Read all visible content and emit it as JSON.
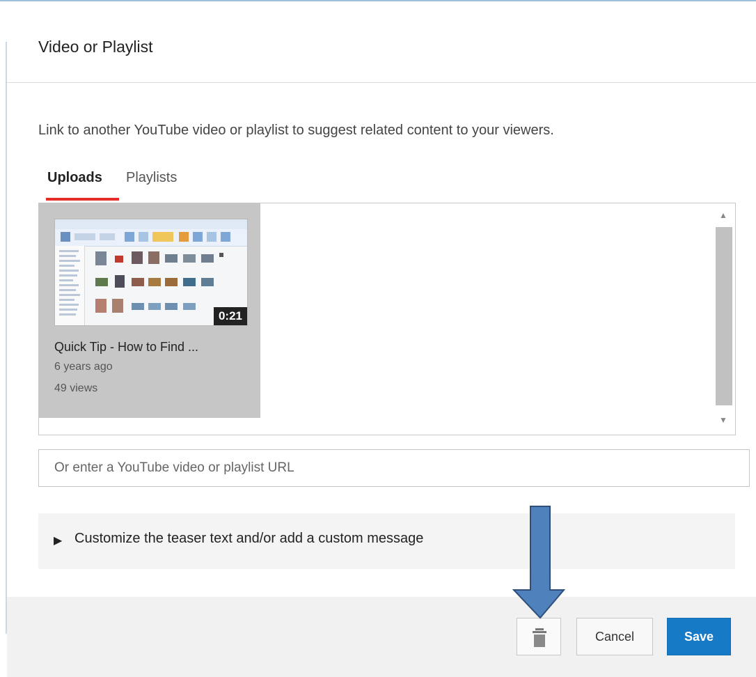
{
  "dialog": {
    "title": "Video or Playlist",
    "description": "Link to another YouTube video or playlist to suggest related content to your viewers."
  },
  "tabs": [
    {
      "label": "Uploads",
      "active": true
    },
    {
      "label": "Playlists",
      "active": false
    }
  ],
  "video": {
    "title": "Quick Tip - How to Find ...",
    "duration": "0:21",
    "age": "6 years ago",
    "views": "49 views"
  },
  "url_input": {
    "placeholder": "Or enter a YouTube video or playlist URL",
    "value": ""
  },
  "teaser": {
    "label": "Customize the teaser text and/or add a custom message"
  },
  "footer": {
    "delete_icon": "trash-icon",
    "cancel_label": "Cancel",
    "save_label": "Save"
  },
  "colors": {
    "tab_underline": "#e52d27",
    "save_button": "#167ac6",
    "annotation_arrow": "#4f81bd"
  }
}
